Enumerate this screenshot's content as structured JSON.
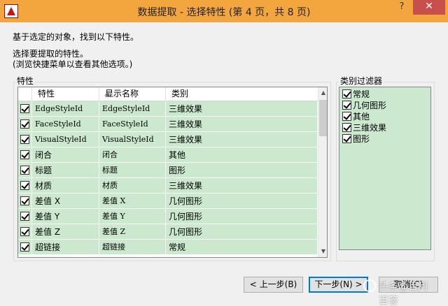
{
  "window": {
    "title": "数据提取 - 选择特性 (第 4 页，共 8 页)",
    "help_label": "?",
    "close_label": "✕"
  },
  "description": {
    "line1": "基于选定的对象，找到以下特性。",
    "line2": "选择要提取的特性。",
    "line3": "(浏览快捷菜单以查看其他选项。)"
  },
  "properties": {
    "group_label": "特性",
    "columns": [
      "特性",
      "显示名称",
      "类别"
    ],
    "rows": [
      {
        "name": "EdgeStyleId",
        "display": "EdgeStyleId",
        "category": "三维效果",
        "checked": true
      },
      {
        "name": "FaceStyleId",
        "display": "FaceStyleId",
        "category": "三维效果",
        "checked": true
      },
      {
        "name": "VisualStyleId",
        "display": "VisualStyleId",
        "category": "三维效果",
        "checked": true
      },
      {
        "name": "闭合",
        "display": "闭合",
        "category": "其他",
        "checked": true
      },
      {
        "name": "标题",
        "display": "标题",
        "category": "图形",
        "checked": true
      },
      {
        "name": "材质",
        "display": "材质",
        "category": "三维效果",
        "checked": true
      },
      {
        "name": "差值 X",
        "display": "差值 X",
        "category": "几何图形",
        "checked": true
      },
      {
        "name": "差值 Y",
        "display": "差值 Y",
        "category": "几何图形",
        "checked": true
      },
      {
        "name": "差值 Z",
        "display": "差值 Z",
        "category": "几何图形",
        "checked": true
      },
      {
        "name": "超链接",
        "display": "超链接",
        "category": "常规",
        "checked": true
      }
    ]
  },
  "filter": {
    "group_label": "类别过滤器",
    "items": [
      {
        "label": "常规",
        "checked": true
      },
      {
        "label": "几何图形",
        "checked": true
      },
      {
        "label": "其他",
        "checked": true
      },
      {
        "label": "三维效果",
        "checked": true
      },
      {
        "label": "图形",
        "checked": true
      }
    ]
  },
  "buttons": {
    "back": "< 上一步(B)",
    "next": "下一步(N) >",
    "cancel": "取消(C)"
  },
  "watermark": {
    "text": "头条@百问百答"
  },
  "colors": {
    "titlebar": "#f4a63e",
    "row_bg": "#cce8cf",
    "close_bg": "#c7504c"
  }
}
